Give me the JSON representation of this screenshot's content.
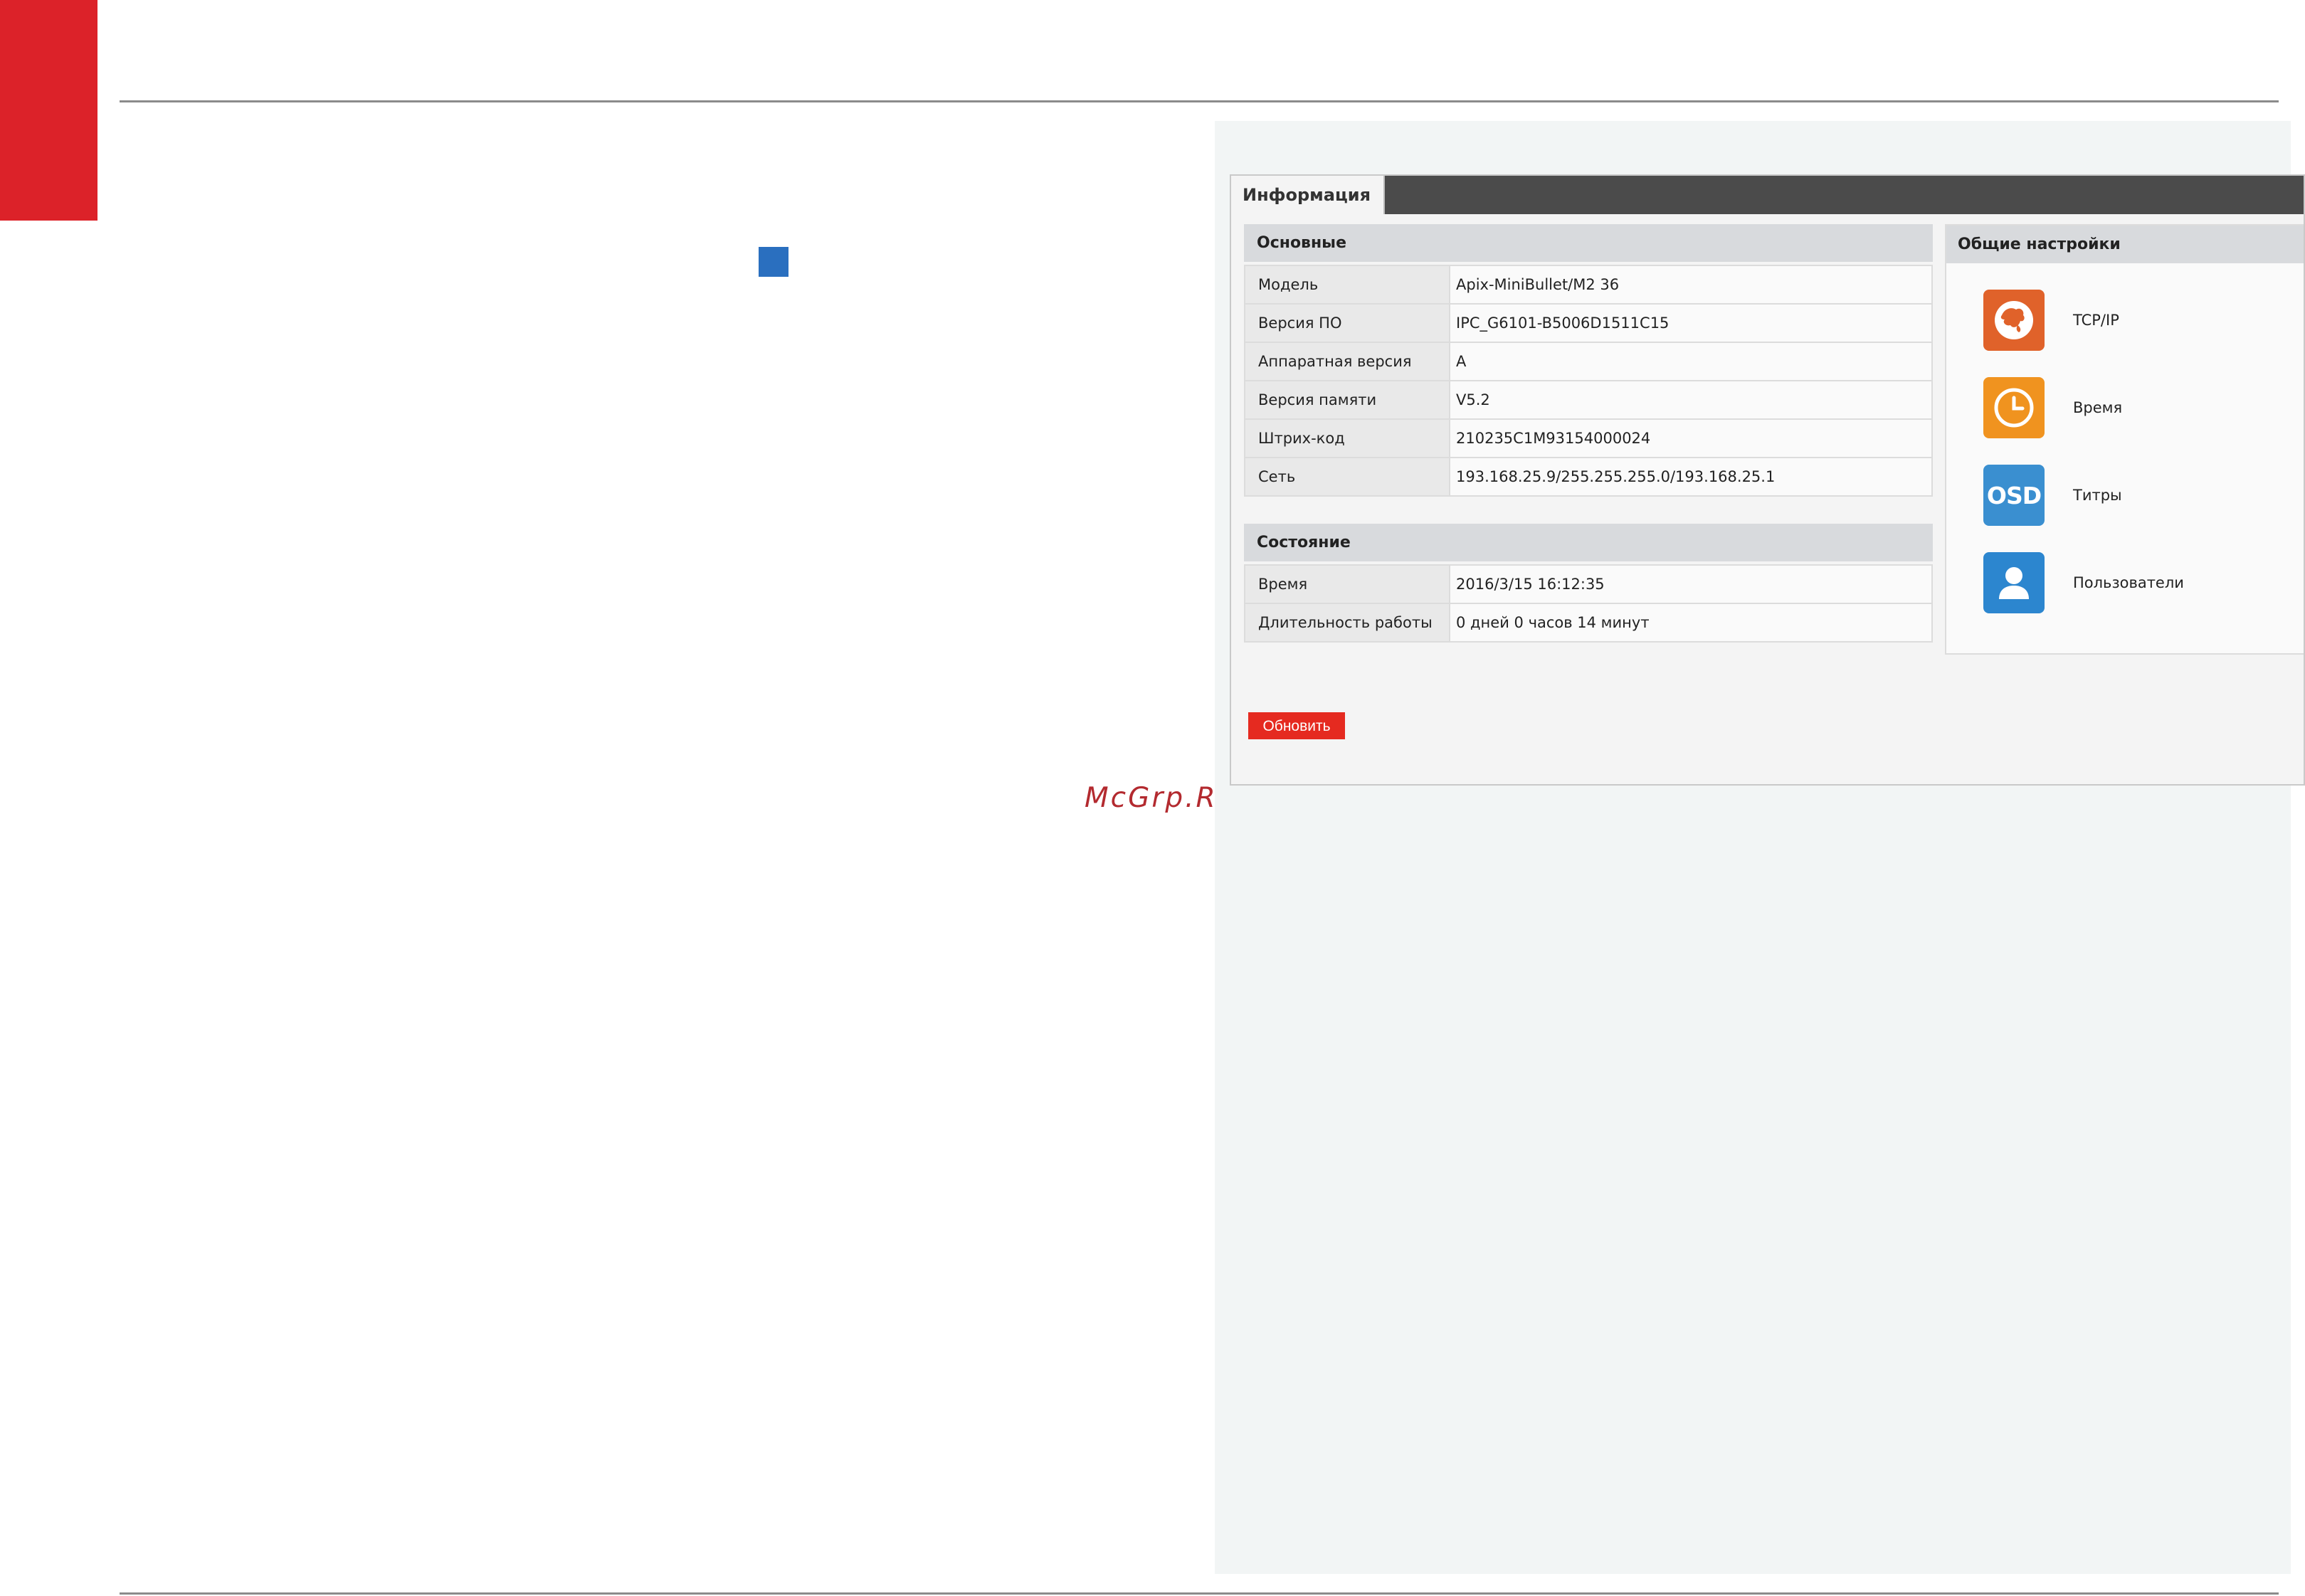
{
  "watermark": "McGrp.Ru",
  "screen": {
    "tab_label": "Информация",
    "basic": {
      "title": "Основные",
      "rows": [
        {
          "key": "Модель",
          "value": "Apix-MiniBullet/M2 36"
        },
        {
          "key": "Версия ПО",
          "value": "IPC_G6101-B5006D1511C15"
        },
        {
          "key": "Аппаратная версия",
          "value": "A"
        },
        {
          "key": "Версия памяти",
          "value": "V5.2"
        },
        {
          "key": "Штрих-код",
          "value": "210235C1M93154000024"
        },
        {
          "key": "Сеть",
          "value": "193.168.25.9/255.255.255.0/193.168.25.1"
        }
      ]
    },
    "status": {
      "title": "Состояние",
      "rows": [
        {
          "key": "Время",
          "value": "2016/3/15 16:12:35"
        },
        {
          "key": "Длительность работы",
          "value": "0 дней 0 часов 14 минут"
        }
      ]
    },
    "refresh_button": "Обновить",
    "general": {
      "title": "Общие настройки",
      "items": [
        {
          "label": "TCP/IP",
          "icon": "globe-icon",
          "color": "#e0622a"
        },
        {
          "label": "Время",
          "icon": "clock-icon",
          "color": "#f0931f"
        },
        {
          "label": "Титры",
          "icon": "osd-icon",
          "icon_text": "OSD",
          "color": "#3a8fd0"
        },
        {
          "label": "Пользователи",
          "icon": "user-icon",
          "color": "#2c86cf"
        }
      ]
    }
  }
}
